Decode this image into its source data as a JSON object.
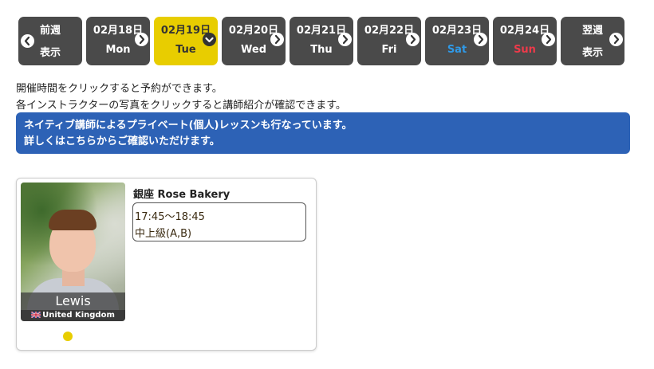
{
  "daybar": {
    "prev": {
      "line1": "前週",
      "line2": "表示"
    },
    "days": [
      {
        "date": "02月18日",
        "weekday": "Mon",
        "kind": "normal"
      },
      {
        "date": "02月19日",
        "weekday": "Tue",
        "kind": "active"
      },
      {
        "date": "02月20日",
        "weekday": "Wed",
        "kind": "normal"
      },
      {
        "date": "02月21日",
        "weekday": "Thu",
        "kind": "normal"
      },
      {
        "date": "02月22日",
        "weekday": "Fri",
        "kind": "normal"
      },
      {
        "date": "02月23日",
        "weekday": "Sat",
        "kind": "sat"
      },
      {
        "date": "02月24日",
        "weekday": "Sun",
        "kind": "sun"
      }
    ],
    "next": {
      "line1": "翌週",
      "line2": "表示"
    }
  },
  "info": {
    "line1": "開催時間をクリックすると予約ができます。",
    "line2": "各インストラクターの写真をクリックすると講師紹介が確認できます。"
  },
  "banner": {
    "line1": "ネイティブ講師によるプライベート(個人)レッスンも行なっています。",
    "line2": "詳しくはこちらからご確認いただけます。"
  },
  "colors": {
    "accent": "#e8cd00",
    "day_bg": "#4a4a4a",
    "banner": "#2d62b6",
    "sat": "#2f9ae8",
    "sun": "#ee3a4a"
  },
  "instructor": {
    "name": "Lewis",
    "country": "United Kingdom",
    "school": "銀座 Rose Bakery",
    "lesson_time": "17:45〜18:45",
    "lesson_level": "中上級(A,B)"
  }
}
